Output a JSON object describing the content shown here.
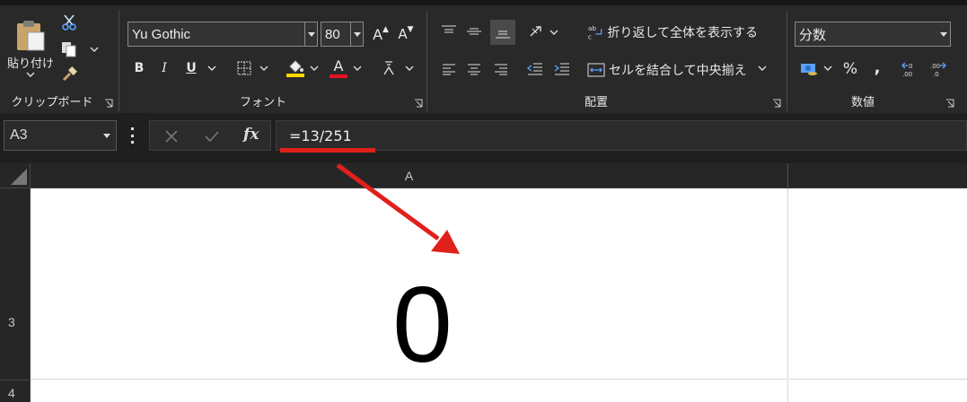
{
  "ribbon": {
    "clipboard": {
      "paste_label": "貼り付け",
      "group_label": "クリップボード"
    },
    "font": {
      "font_name": "Yu Gothic",
      "font_size": "80",
      "group_label": "フォント",
      "bold": "B",
      "italic": "I",
      "underline": "U",
      "font_color_glyph": "A",
      "grow_glyph": "A",
      "shrink_glyph": "A"
    },
    "alignment": {
      "wrap_label": "折り返して全体を表示する",
      "merge_label": "セルを結合して中央揃え",
      "group_label": "配置"
    },
    "number": {
      "format": "分数",
      "percent": "%",
      "comma": ",",
      "group_label": "数値"
    }
  },
  "formula_bar": {
    "name_box": "A3",
    "fx": "fx",
    "formula": "=13/251"
  },
  "sheet": {
    "column_a": "A",
    "row_3": "3",
    "row_4": "4",
    "cell_a3_value": "0"
  },
  "colors": {
    "ribbon_bg": "#292929",
    "highlight_yellow": "#ffd800",
    "font_red": "#e81123",
    "annotation_red": "#e0201b"
  }
}
